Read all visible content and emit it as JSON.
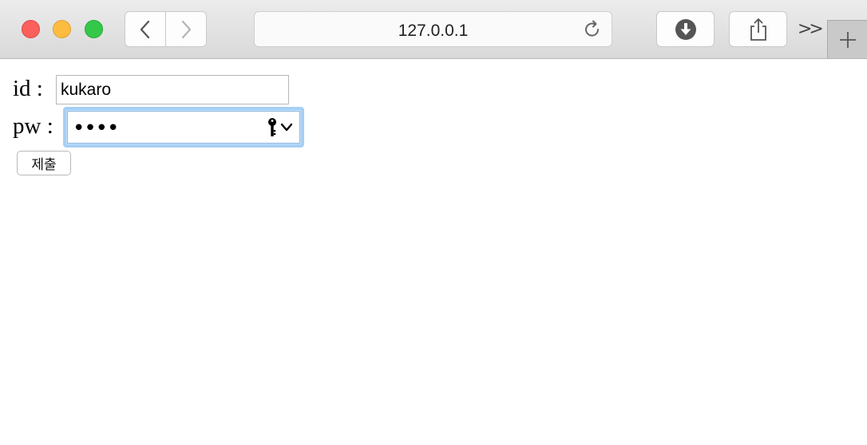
{
  "browser": {
    "url": "127.0.0.1",
    "icons": {
      "back": "chevron-left-icon",
      "forward": "chevron-right-icon",
      "reload": "reload-icon",
      "download": "download-icon",
      "share": "share-icon",
      "more": "double-chevron-right-icon",
      "new_tab": "plus-icon"
    },
    "more_glyph": ">>"
  },
  "form": {
    "id_label": "id :",
    "id_value": "kukaro",
    "pw_label": "pw :",
    "pw_masked": "••••",
    "submit_label": "제출",
    "focus_color": "#a6cff5"
  }
}
